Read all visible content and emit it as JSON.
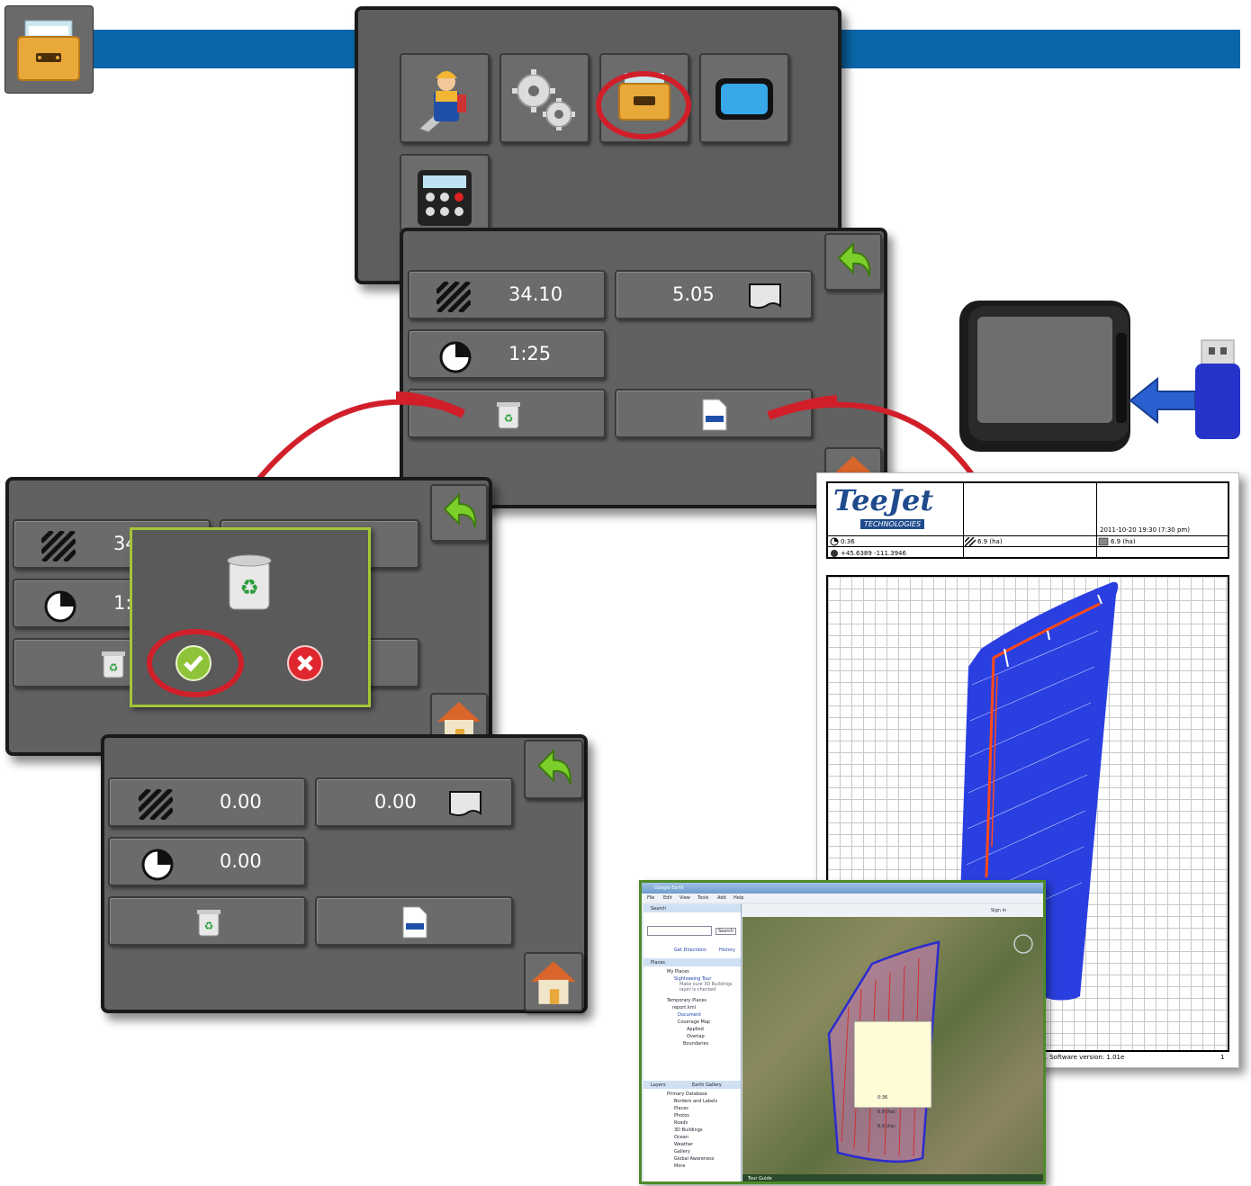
{
  "colors": {
    "header_bar": "#0a66a8",
    "panel_bg": "#616161",
    "highlight_ring": "#d11f2a",
    "dialog_border": "#a4c639",
    "coverage_blue": "#2a3fe0"
  },
  "header": {
    "app_icon": "file-cabinet-icon"
  },
  "menu": {
    "items": [
      {
        "name": "operator-icon"
      },
      {
        "name": "gears-icon"
      },
      {
        "name": "file-cabinet-icon",
        "highlighted": true
      },
      {
        "name": "display-icon"
      },
      {
        "name": "calculator-icon"
      }
    ]
  },
  "summary_top": {
    "area_value": "34.10",
    "total_value": "5.05",
    "time_value": "1:25"
  },
  "summary_dialog": {
    "area_value": "34",
    "time_value": "1:"
  },
  "summary_reset": {
    "area_value": "0.00",
    "total_value": "0.00",
    "time_value": "0.00"
  },
  "report": {
    "logo_text": "TeeJet",
    "logo_sub": "TECHNOLOGIES",
    "datetime": "2011-10-20 19:30 (7:30 pm)",
    "time": "0:36",
    "area_applied": "6.9 (ha)",
    "area_total": "6.9 (ha)",
    "coordinates": "+45.6389 -111.3946",
    "footer_software": "s. Software version: 1.01e",
    "footer_page": "1"
  },
  "google_earth": {
    "title": "Google Earth",
    "menu": [
      "File",
      "Edit",
      "View",
      "Tools",
      "Add",
      "Help"
    ],
    "search_label": "Search",
    "search_button": "Search",
    "get_directions": "Get Directions",
    "history": "History",
    "places_label": "Places",
    "layers_label": "Layers",
    "earth_gallery": "Earth Gallery",
    "sign_in": "Sign in",
    "tour_guide": "Tour Guide",
    "tree": [
      "My Places",
      "Sightseeing Tour",
      "Make sure 3D Buildings",
      "layer is checked",
      "Temporary Places",
      "report.kml",
      "Document",
      "Coverage Map",
      "Applied",
      "Overlap",
      "Boundaries"
    ],
    "layer_tree": [
      "Primary Database",
      "Borders and Labels",
      "Places",
      "Photos",
      "Roads",
      "3D Buildings",
      "Ocean",
      "Weather",
      "Gallery",
      "Global Awareness",
      "More"
    ],
    "popup_values": [
      "0:36",
      "6.9 (ha)",
      "6.9 (ha)"
    ]
  }
}
